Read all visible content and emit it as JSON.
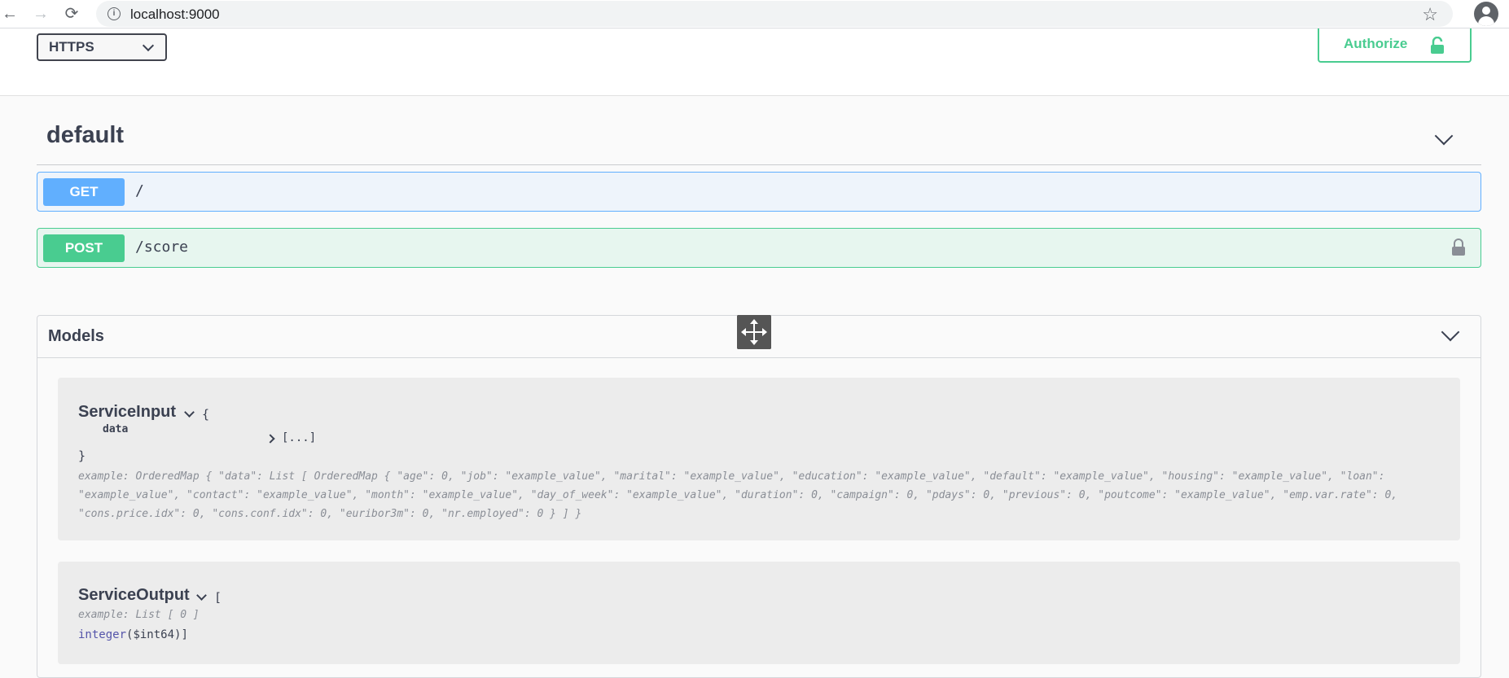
{
  "browser": {
    "back_icon": "arrow-left-icon",
    "forward_icon": "arrow-right-icon",
    "reload_icon": "reload-icon",
    "url": "localhost:9000",
    "bookmark_icon": "star-icon",
    "profile_icon": "account-circle-icon"
  },
  "scheme": {
    "selected": "HTTPS",
    "options": [
      "HTTPS"
    ]
  },
  "authorize": {
    "label": "Authorize"
  },
  "tag": {
    "title": "default"
  },
  "operations": [
    {
      "method": "GET",
      "path": "/"
    },
    {
      "method": "POST",
      "path": "/score"
    }
  ],
  "models": {
    "title": "Models",
    "service_input": {
      "name": "ServiceInput",
      "open_brace": "{",
      "prop_name": "data",
      "prop_value": "[...]",
      "close_brace": "}",
      "example": "example: OrderedMap { \"data\": List [ OrderedMap { \"age\": 0, \"job\": \"example_value\", \"marital\": \"example_value\", \"education\": \"example_value\", \"default\": \"example_value\", \"housing\": \"example_value\", \"loan\": \"example_value\", \"contact\": \"example_value\", \"month\": \"example_value\", \"day_of_week\": \"example_value\", \"duration\": 0, \"campaign\": 0, \"pdays\": 0, \"previous\": 0, \"poutcome\": \"example_value\", \"emp.var.rate\": 0, \"cons.price.idx\": 0, \"cons.conf.idx\": 0, \"euribor3m\": 0, \"nr.employed\": 0 } ] }"
    },
    "service_output": {
      "name": "ServiceOutput",
      "open_bracket": "[",
      "example": "example: List [ 0 ]",
      "type": "integer",
      "format": "($int64)]"
    }
  },
  "colors": {
    "get": "#61affe",
    "post": "#49cc90",
    "text": "#3b4151"
  }
}
